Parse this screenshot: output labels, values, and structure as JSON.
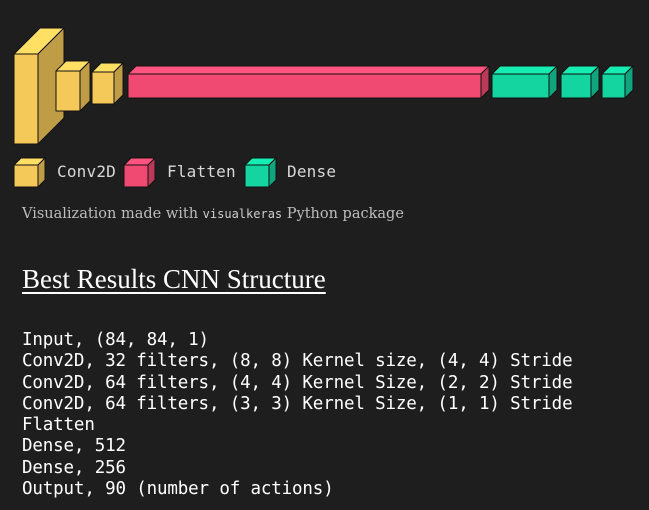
{
  "colors": {
    "conv2d": "#f5c85a",
    "flatten": "#f04a72",
    "dense": "#14d4a0",
    "background": "#1e1e1e"
  },
  "legend": [
    {
      "label": "Conv2D",
      "color": "#f5c85a"
    },
    {
      "label": "Flatten",
      "color": "#f04a72"
    },
    {
      "label": "Dense",
      "color": "#14d4a0"
    }
  ],
  "caption": {
    "prefix": "Visualization made with",
    "package": "visualkeras",
    "suffix": "Python package"
  },
  "heading": "Best Results CNN Structure",
  "structure_lines": [
    "Input, (84, 84, 1)",
    "Conv2D, 32 filters, (8, 8) Kernel size, (4, 4) Stride",
    "Conv2D, 64 filters, (4, 4) Kernel Size, (2, 2) Stride",
    "Conv2D, 64 filters, (3, 3) Kernel Size, (1, 1) Stride",
    "Flatten",
    "Dense, 512",
    "Dense, 256",
    "Output, 90 (number of actions)"
  ]
}
